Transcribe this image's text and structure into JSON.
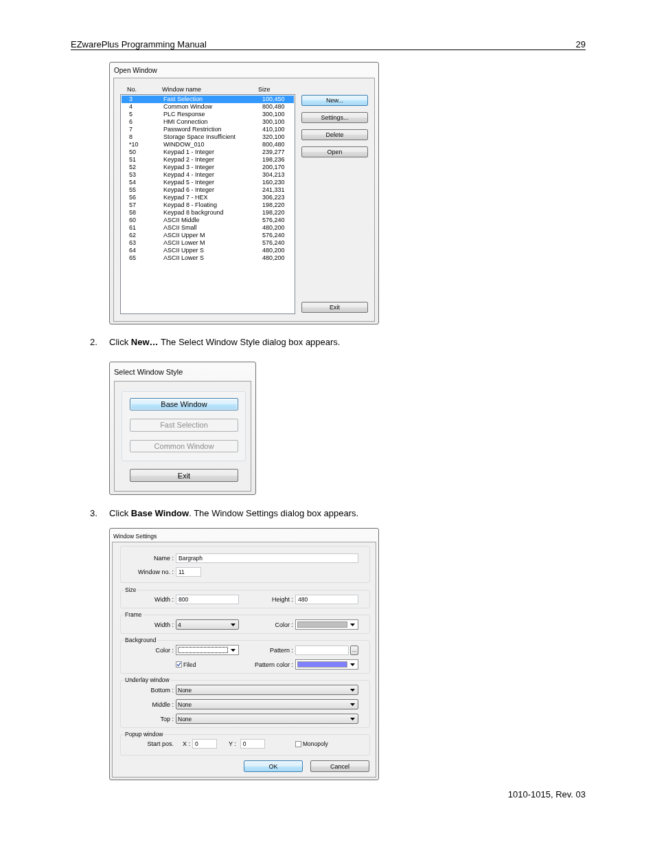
{
  "header": {
    "title": "EZwarePlus Programming Manual",
    "page": "29"
  },
  "open_window": {
    "title": "Open Window",
    "columns": [
      "No.",
      "Window name",
      "Size"
    ],
    "rows": [
      {
        "no": "3",
        "name": "Fast Selection",
        "size": "100,450",
        "selected": true
      },
      {
        "no": "4",
        "name": "Common Window",
        "size": "800,480",
        "selected": false
      },
      {
        "no": "5",
        "name": "PLC Response",
        "size": "300,100",
        "selected": false
      },
      {
        "no": "6",
        "name": "HMI Connection",
        "size": "300,100",
        "selected": false
      },
      {
        "no": "7",
        "name": "Password Restriction",
        "size": "410,100",
        "selected": false
      },
      {
        "no": "8",
        "name": "Storage Space Insufficient",
        "size": "320,100",
        "selected": false
      },
      {
        "no": "*10",
        "name": "WINDOW_010",
        "size": "800,480",
        "selected": false
      },
      {
        "no": "50",
        "name": "Keypad 1 - Integer",
        "size": "239,277",
        "selected": false
      },
      {
        "no": "51",
        "name": "Keypad 2 - Integer",
        "size": "198,236",
        "selected": false
      },
      {
        "no": "52",
        "name": "Keypad 3 - Integer",
        "size": "200,170",
        "selected": false
      },
      {
        "no": "53",
        "name": "Keypad 4 - Integer",
        "size": "304,213",
        "selected": false
      },
      {
        "no": "54",
        "name": "Keypad 5 - Integer",
        "size": "160,230",
        "selected": false
      },
      {
        "no": "55",
        "name": "Keypad 6 - Integer",
        "size": "241,331",
        "selected": false
      },
      {
        "no": "56",
        "name": "Keypad 7 - HEX",
        "size": "306,223",
        "selected": false
      },
      {
        "no": "57",
        "name": "Keypad 8 - Floating",
        "size": "198,220",
        "selected": false
      },
      {
        "no": "58",
        "name": "Keypad 8 background",
        "size": "198,220",
        "selected": false
      },
      {
        "no": "60",
        "name": "ASCII Middle",
        "size": "576,240",
        "selected": false
      },
      {
        "no": "61",
        "name": "ASCII Small",
        "size": "480,200",
        "selected": false
      },
      {
        "no": "62",
        "name": "ASCII Upper M",
        "size": "576,240",
        "selected": false
      },
      {
        "no": "63",
        "name": "ASCII Lower M",
        "size": "576,240",
        "selected": false
      },
      {
        "no": "64",
        "name": "ASCII Upper S",
        "size": "480,200",
        "selected": false
      },
      {
        "no": "65",
        "name": "ASCII Lower S",
        "size": "480,200",
        "selected": false
      }
    ],
    "buttons": [
      {
        "label": "New...",
        "default": true
      },
      {
        "label": "Settings...",
        "default": false
      },
      {
        "label": "Delete",
        "default": false
      },
      {
        "label": "Open",
        "default": false
      }
    ],
    "exit_button": "Exit"
  },
  "step_2": {
    "number": "2.",
    "text": "Click **New…** The Select Window Style dialog box appears."
  },
  "select_style": {
    "title": "Select Window Style",
    "options": [
      {
        "label": "Base Window",
        "default": true,
        "disabled": false
      },
      {
        "label": "Fast Selection",
        "default": false,
        "disabled": true
      },
      {
        "label": "Common Window",
        "default": false,
        "disabled": true
      }
    ],
    "exit_button": "Exit"
  },
  "step_3": {
    "number": "3.",
    "text": "Click **Base Window**. The Window Settings dialog box appears."
  },
  "window_settings": {
    "title": "Window Settings",
    "name": {
      "label": "Name :",
      "value": "Bargraph"
    },
    "window_no": {
      "label": "Window no. :",
      "value": "11"
    },
    "size": {
      "legend": "Size",
      "width": {
        "label": "Width :",
        "value": "800"
      },
      "height": {
        "label": "Height :",
        "value": "480"
      }
    },
    "frame": {
      "legend": "Frame",
      "width": {
        "label": "Width :",
        "value": "4"
      },
      "color": {
        "label": "Color :",
        "color": "#c0c0c0"
      }
    },
    "background": {
      "legend": "Background",
      "color": {
        "label": "Color :",
        "color": "#ffffff"
      },
      "pattern": {
        "label": "Pattern :",
        "browse": "..."
      },
      "filled": {
        "label": "Filed",
        "checked": true
      },
      "pattern_color": {
        "label": "Pattern color :",
        "color": "#8080ff"
      }
    },
    "underlay": {
      "legend": "Underlay window",
      "layers": [
        {
          "label": "Bottom :",
          "value": "None"
        },
        {
          "label": "Middle :",
          "value": "None"
        },
        {
          "label": "Top :",
          "value": "None"
        }
      ]
    },
    "popup": {
      "legend": "Popup window",
      "start_label": "Start pos.",
      "x": {
        "label": "X :",
        "value": "0"
      },
      "y": {
        "label": "Y :",
        "value": "0"
      },
      "monopoly": {
        "label": "Monopoly",
        "checked": false
      }
    },
    "buttons": [
      {
        "label": "OK",
        "default": true
      },
      {
        "label": "Cancel",
        "default": false
      }
    ]
  },
  "footer": "1010-1015, Rev. 03"
}
